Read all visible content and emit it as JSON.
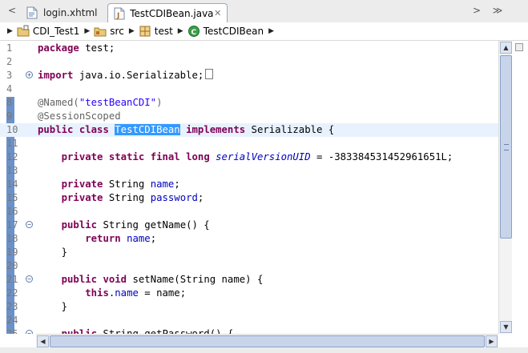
{
  "tabs": {
    "nav_left": "<",
    "nav_right": ">",
    "overflow": "≫",
    "items": [
      {
        "label": "login.xhtml",
        "icon": "xhtml-file-icon"
      },
      {
        "label": "TestCDIBean.java",
        "icon": "java-file-icon",
        "close": "✕"
      }
    ]
  },
  "breadcrumb": {
    "items": [
      {
        "label": "CDI_Test1",
        "icon": "project-icon"
      },
      {
        "label": "src",
        "icon": "source-folder-icon"
      },
      {
        "label": "test",
        "icon": "package-icon"
      },
      {
        "label": "TestCDIBean",
        "icon": "class-icon"
      }
    ],
    "separator": "▶"
  },
  "colors": {
    "keyword": "#7f0055",
    "string": "#2a00ff",
    "field": "#0000c0",
    "annotation": "#646464",
    "selection": "#3399ff",
    "current_line": "#e8f2fe"
  },
  "scroll": {
    "up": "▲",
    "down": "▼",
    "left": "◀",
    "right": "▶"
  },
  "code": {
    "lines": [
      {
        "n": "1",
        "parts": [
          [
            "kw",
            "package"
          ],
          [
            "t",
            " test;"
          ]
        ]
      },
      {
        "n": "2",
        "parts": []
      },
      {
        "n": "3",
        "fold": "+",
        "parts": [
          [
            "kw",
            "import"
          ],
          [
            "t",
            " java.io.Serializable;"
          ]
        ],
        "box": true
      },
      {
        "n": "4",
        "parts": []
      },
      {
        "n": "8",
        "parts": [
          [
            "ann",
            "@Named("
          ],
          [
            "str",
            "\"testBeanCDI\""
          ],
          [
            "ann",
            ")"
          ]
        ]
      },
      {
        "n": "9",
        "parts": [
          [
            "ann",
            "@SessionScoped"
          ]
        ]
      },
      {
        "n": "10",
        "current": true,
        "parts": [
          [
            "kw",
            "public"
          ],
          [
            "t",
            " "
          ],
          [
            "kw",
            "class"
          ],
          [
            "t",
            " "
          ],
          [
            "sel",
            "TestCDIBean"
          ],
          [
            "t",
            " "
          ],
          [
            "kw",
            "implements"
          ],
          [
            "t",
            " Serializable {"
          ]
        ]
      },
      {
        "n": "11",
        "parts": []
      },
      {
        "n": "12",
        "parts": [
          [
            "t",
            "    "
          ],
          [
            "kw",
            "private"
          ],
          [
            "t",
            " "
          ],
          [
            "kw",
            "static"
          ],
          [
            "t",
            " "
          ],
          [
            "kw",
            "final"
          ],
          [
            "t",
            " "
          ],
          [
            "kw",
            "long"
          ],
          [
            "t",
            " "
          ],
          [
            "sfld",
            "serialVersionUID"
          ],
          [
            "t",
            " = -383384531452961651L;"
          ]
        ]
      },
      {
        "n": "13",
        "parts": []
      },
      {
        "n": "14",
        "parts": [
          [
            "t",
            "    "
          ],
          [
            "kw",
            "private"
          ],
          [
            "t",
            " String "
          ],
          [
            "fld",
            "name"
          ],
          [
            "t",
            ";"
          ]
        ]
      },
      {
        "n": "15",
        "parts": [
          [
            "t",
            "    "
          ],
          [
            "kw",
            "private"
          ],
          [
            "t",
            " String "
          ],
          [
            "fld",
            "password"
          ],
          [
            "t",
            ";"
          ]
        ]
      },
      {
        "n": "16",
        "parts": []
      },
      {
        "n": "17",
        "fold": "−",
        "parts": [
          [
            "t",
            "    "
          ],
          [
            "kw",
            "public"
          ],
          [
            "t",
            " String getName() {"
          ]
        ]
      },
      {
        "n": "18",
        "parts": [
          [
            "t",
            "        "
          ],
          [
            "kw",
            "return"
          ],
          [
            "t",
            " "
          ],
          [
            "fld",
            "name"
          ],
          [
            "t",
            ";"
          ]
        ]
      },
      {
        "n": "19",
        "parts": [
          [
            "t",
            "    }"
          ]
        ]
      },
      {
        "n": "20",
        "parts": []
      },
      {
        "n": "21",
        "fold": "−",
        "parts": [
          [
            "t",
            "    "
          ],
          [
            "kw",
            "public"
          ],
          [
            "t",
            " "
          ],
          [
            "kw",
            "void"
          ],
          [
            "t",
            " setName(String name) {"
          ]
        ]
      },
      {
        "n": "22",
        "parts": [
          [
            "t",
            "        "
          ],
          [
            "kw",
            "this"
          ],
          [
            "t",
            "."
          ],
          [
            "fld",
            "name"
          ],
          [
            "t",
            " = name;"
          ]
        ]
      },
      {
        "n": "23",
        "parts": [
          [
            "t",
            "    }"
          ]
        ]
      },
      {
        "n": "24",
        "parts": []
      },
      {
        "n": "25",
        "fold": "−",
        "parts": [
          [
            "t",
            "    "
          ],
          [
            "kw",
            "public"
          ],
          [
            "t",
            " String getPassword() {"
          ]
        ]
      }
    ]
  }
}
